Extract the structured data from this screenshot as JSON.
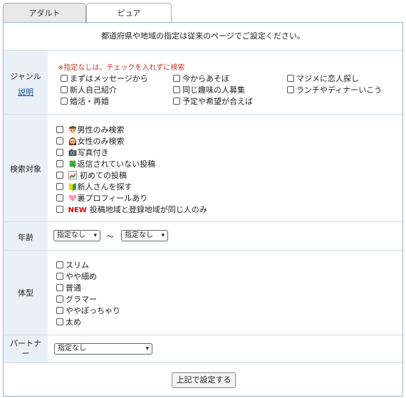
{
  "tabs": {
    "adult": "アダルト",
    "pure": "ピュア"
  },
  "notice": "都道府県や地域の指定は従来のページでご設定ください。",
  "genre": {
    "label": "ジャンル",
    "help": "説明",
    "note": "※指定なしは、チェックを入れずに検索",
    "options": [
      "まずはメッセージから",
      "今からあそぼ",
      "マジメに恋人探し",
      "新人自己紹介",
      "同じ趣味の人募集",
      "ランチやディナーいこう",
      "婚活・再婚",
      "予定や希望が合えば"
    ]
  },
  "target": {
    "label": "検索対象",
    "options": [
      {
        "text": "男性のみ検索",
        "icon": "man-face-icon"
      },
      {
        "text": "女性のみ検索",
        "icon": "woman-face-icon"
      },
      {
        "text": "写真付き",
        "icon": "camera-icon"
      },
      {
        "text": "返信されていない投稿",
        "icon": "clover-icon"
      },
      {
        "text": " 初めての投稿",
        "icon": "chart-icon"
      },
      {
        "text": "新人さんを探す",
        "icon": "beginner-mark-icon"
      },
      {
        "text": "裏プロフィールあり",
        "icon": "heart-icon"
      },
      {
        "text": "投稿地域と登録地域が同じ人のみ",
        "icon": "new-badge",
        "badge": "NEW"
      }
    ]
  },
  "age": {
    "label": "年齢",
    "from": "指定なし",
    "to": "指定なし",
    "separator": "〜"
  },
  "body_type": {
    "label": "体型",
    "options": [
      "スリム",
      "やや細め",
      "普通",
      "グラマー",
      "ややぽっちゃり",
      "太め"
    ]
  },
  "partner": {
    "label": "パートナー",
    "value": "指定なし"
  },
  "submit": "上記で設定する",
  "colors": {
    "link": "#1f4e9c",
    "note": "#c0392b",
    "label_bg": "#e9f0f8",
    "border": "#9ab5d2",
    "new": "#e00000"
  }
}
